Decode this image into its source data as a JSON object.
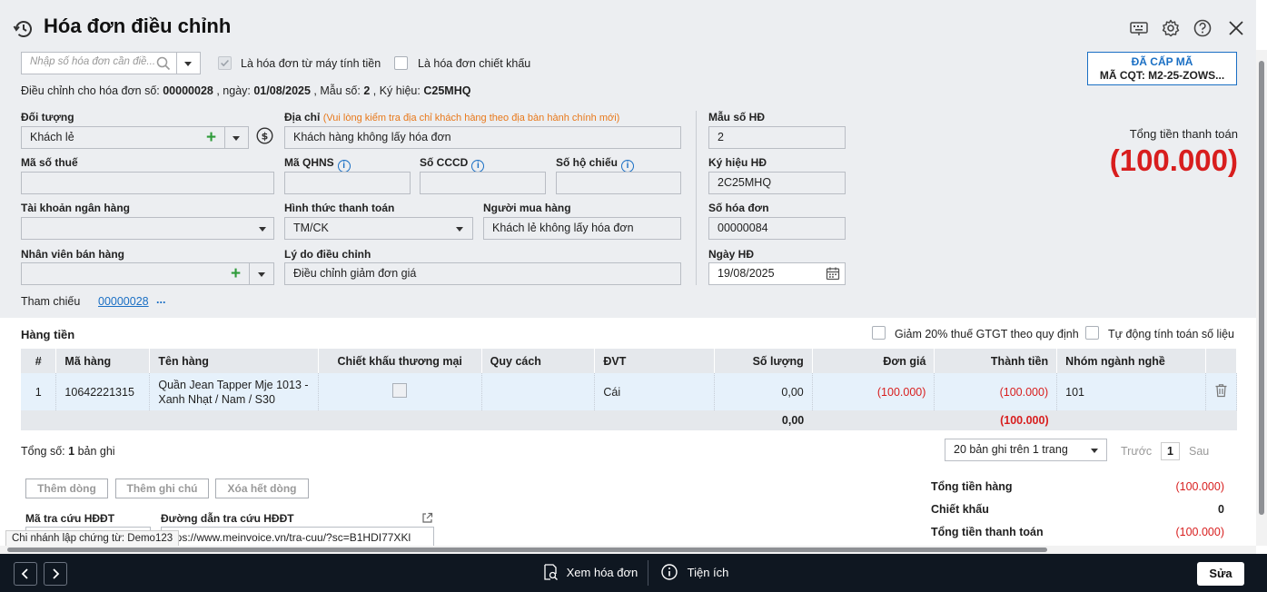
{
  "header": {
    "title": "Hóa đơn điều chỉnh"
  },
  "search": {
    "placeholder": "Nhập số hóa đơn cần điề..."
  },
  "checks": {
    "from_register": "Là hóa đơn từ máy tính tiền",
    "discount_invoice": "Là hóa đơn chiết khấu"
  },
  "adjust_info": {
    "prefix": "Điều chỉnh cho hóa đơn số:",
    "number": "00000028",
    "date_label": ", ngày:",
    "date": "01/08/2025",
    "form_label": ", Mẫu số:",
    "form": "2",
    "symbol_label": ", Ký hiệu:",
    "symbol": "C25MHQ"
  },
  "status_box": {
    "status": "ĐÃ CẤP MÃ",
    "cqt_code": "MÃ CQT: M2-25-ZOWS..."
  },
  "form": {
    "doi_tuong": {
      "label": "Đối tượng",
      "value": "Khách lẻ"
    },
    "dia_chi": {
      "label": "Địa chỉ",
      "note": "(Vui lòng kiểm tra địa chỉ khách hàng theo địa bàn hành chính mới)",
      "value": "Khách hàng không lấy hóa đơn"
    },
    "ma_so_thue": {
      "label": "Mã số thuế",
      "value": ""
    },
    "ma_qhns": {
      "label": "Mã QHNS",
      "value": ""
    },
    "so_cccd": {
      "label": "Số CCCD",
      "value": ""
    },
    "so_ho_chieu": {
      "label": "Số hộ chiếu",
      "value": ""
    },
    "tai_khoan": {
      "label": "Tài khoản ngân hàng",
      "value": ""
    },
    "hinh_thuc_tt": {
      "label": "Hình thức thanh toán",
      "value": "TM/CK"
    },
    "nguoi_mua": {
      "label": "Người mua hàng",
      "value": "Khách lẻ không lấy hóa đơn"
    },
    "nhan_vien": {
      "label": "Nhân viên bán hàng",
      "value": ""
    },
    "ly_do": {
      "label": "Lý do điều chỉnh",
      "value": "Điều chỉnh giảm đơn giá"
    },
    "tham_chieu": {
      "label": "Tham chiếu",
      "value": "00000028",
      "more": "..."
    }
  },
  "right_panel": {
    "mau_so": {
      "label": "Mẫu số HĐ",
      "value": "2"
    },
    "ky_hieu": {
      "label": "Ký hiệu HĐ",
      "value": "2C25MHQ"
    },
    "so_hd": {
      "label": "Số hóa đơn",
      "value": "00000084"
    },
    "ngay_hd": {
      "label": "Ngày HĐ",
      "value": "19/08/2025"
    }
  },
  "total": {
    "label": "Tổng tiền thanh toán",
    "value": "(100.000)"
  },
  "items_section": {
    "title": "Hàng tiền",
    "vat_check": "Giảm 20% thuế GTGT theo quy định",
    "auto_check": "Tự động tính toán số liệu",
    "columns": [
      "#",
      "Mã hàng",
      "Tên hàng",
      "Chiết khấu thương mại",
      "Quy cách",
      "ĐVT",
      "Số lượng",
      "Đơn giá",
      "Thành tiền",
      "Nhóm ngành nghề"
    ],
    "row": {
      "idx": "1",
      "code": "10642221315",
      "name": "Quần Jean Tapper Mje 1013 - Xanh Nhạt / Nam / S30",
      "spec": "",
      "unit": "Cái",
      "qty": "0,00",
      "price": "(100.000)",
      "amount": "(100.000)",
      "group": "101"
    },
    "footer": {
      "qty": "0,00",
      "amount": "(100.000)"
    }
  },
  "paging": {
    "count_label": "Tổng số:",
    "count": "1",
    "count_suffix": "bản ghi",
    "page_size": "20 bản ghi trên 1 trang",
    "prev": "Trước",
    "page": "1",
    "next": "Sau"
  },
  "actions": {
    "add_row": "Thêm dòng",
    "add_note": "Thêm ghi chú",
    "delete_all": "Xóa hết dòng"
  },
  "lookup": {
    "code_label": "Mã tra cứu HĐĐT",
    "url_label": "Đường dẫn tra cứu HĐĐT",
    "url_value": ":tps://www.meinvoice.vn/tra-cuu/?sc=B1HDI77XKl",
    "tooltip": "Chi nhánh lập chứng từ: Demo123"
  },
  "summary": {
    "goods_label": "Tổng tiền hàng",
    "goods_value": "(100.000)",
    "discount_label": "Chiết khấu",
    "discount_value": "0",
    "total_label": "Tổng tiền thanh toán",
    "total_value": "(100.000)"
  },
  "bottom_bar": {
    "view_invoice": "Xem hóa đơn",
    "utilities": "Tiện ích",
    "edit": "Sửa"
  },
  "colors": {
    "accent": "#1a6fc4",
    "danger": "#d81e1e",
    "add_green": "#2e9b3a",
    "bar_bg": "#0f1721"
  }
}
